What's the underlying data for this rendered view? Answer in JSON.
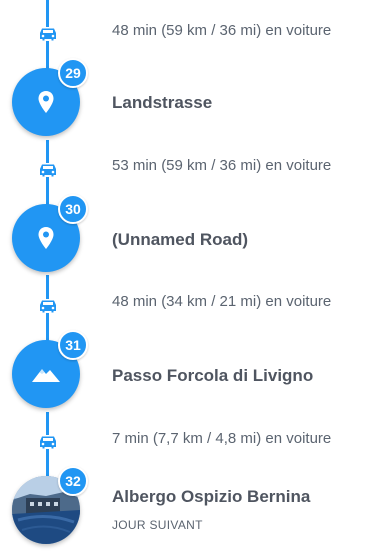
{
  "colors": {
    "accent": "#2196f3",
    "text_primary": "#4f5560",
    "text_secondary": "#5b6470"
  },
  "legs": [
    {
      "icon": "car-icon",
      "text": "48 min (59 km / 36 mi) en voiture"
    },
    {
      "icon": "car-icon",
      "text": "53 min (59 km / 36 mi) en voiture"
    },
    {
      "icon": "car-icon",
      "text": "48 min (34 km / 21 mi) en voiture"
    },
    {
      "icon": "car-icon",
      "text": "7 min (7,7 km / 4,8 mi) en voiture"
    }
  ],
  "stops": [
    {
      "number": "29",
      "icon": "map-pin-icon",
      "name": "Landstrasse"
    },
    {
      "number": "30",
      "icon": "map-pin-icon",
      "name": "(Unnamed Road)"
    },
    {
      "number": "31",
      "icon": "mountain-icon",
      "name": "Passo Forcola di Livigno"
    },
    {
      "number": "32",
      "icon": "hotel-photo",
      "name": "Albergo Ospizio Bernina",
      "subtitle": "JOUR SUIVANT"
    }
  ]
}
